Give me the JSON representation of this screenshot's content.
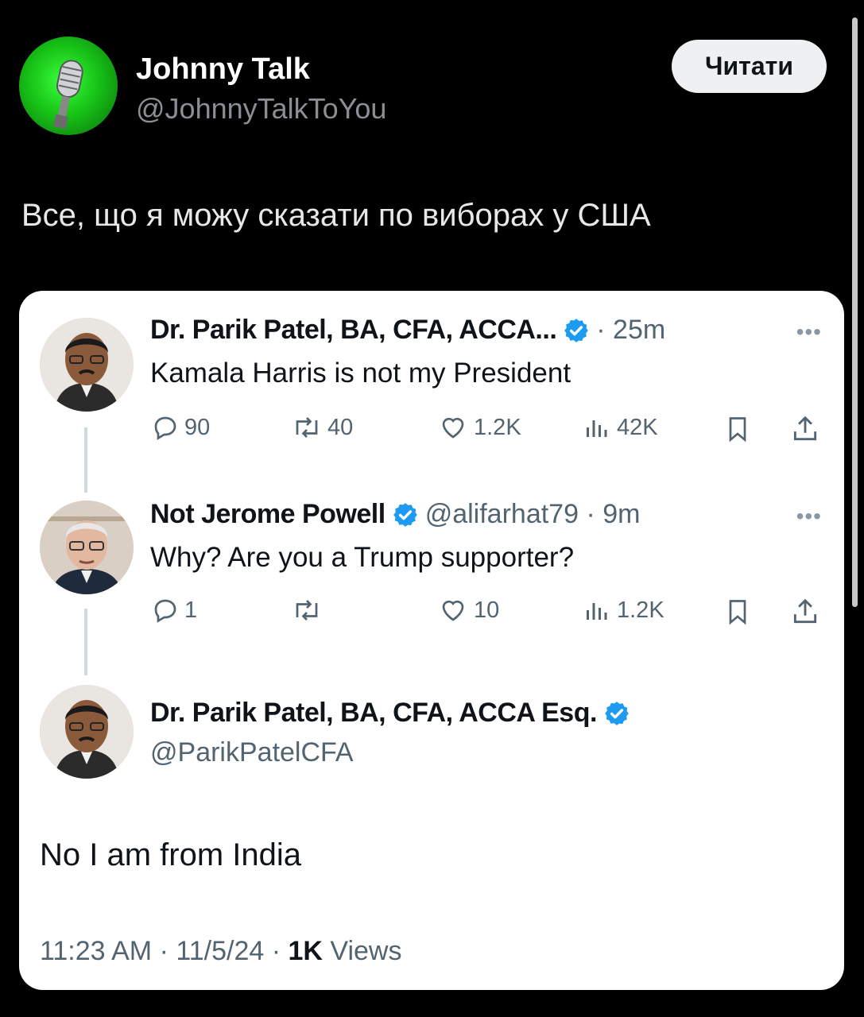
{
  "author": {
    "name": "Johnny Talk",
    "handle": "@JohnnyTalkToYou",
    "follow_label": "Читати"
  },
  "post_text": "Все, що я можу сказати по виборах у США",
  "thread": [
    {
      "name": "Dr. Parik Patel, BA, CFA, ACCA...",
      "time": "· 25m",
      "text": "Kamala Harris is not my President",
      "replies": "90",
      "reposts": "40",
      "likes": "1.2K",
      "views": "42K"
    },
    {
      "name": "Not Jerome Powell",
      "handle_time": "@alifarhat79 · 9m",
      "text": "Why? Are you a Trump supporter?",
      "replies": "1",
      "reposts": "",
      "likes": "10",
      "views": "1.2K"
    }
  ],
  "main_tweet": {
    "name": "Dr. Parik Patel, BA, CFA, ACCA Esq.",
    "handle": "@ParikPatelCFA",
    "text": "No I am from India",
    "timestamp": "11:23 AM · 11/5/24 · ",
    "views_count": "1K",
    "views_label": " Views"
  },
  "more_glyph": "•••",
  "colors": {
    "verified": "#1d9bf0",
    "avatar_green": "#17c317"
  }
}
